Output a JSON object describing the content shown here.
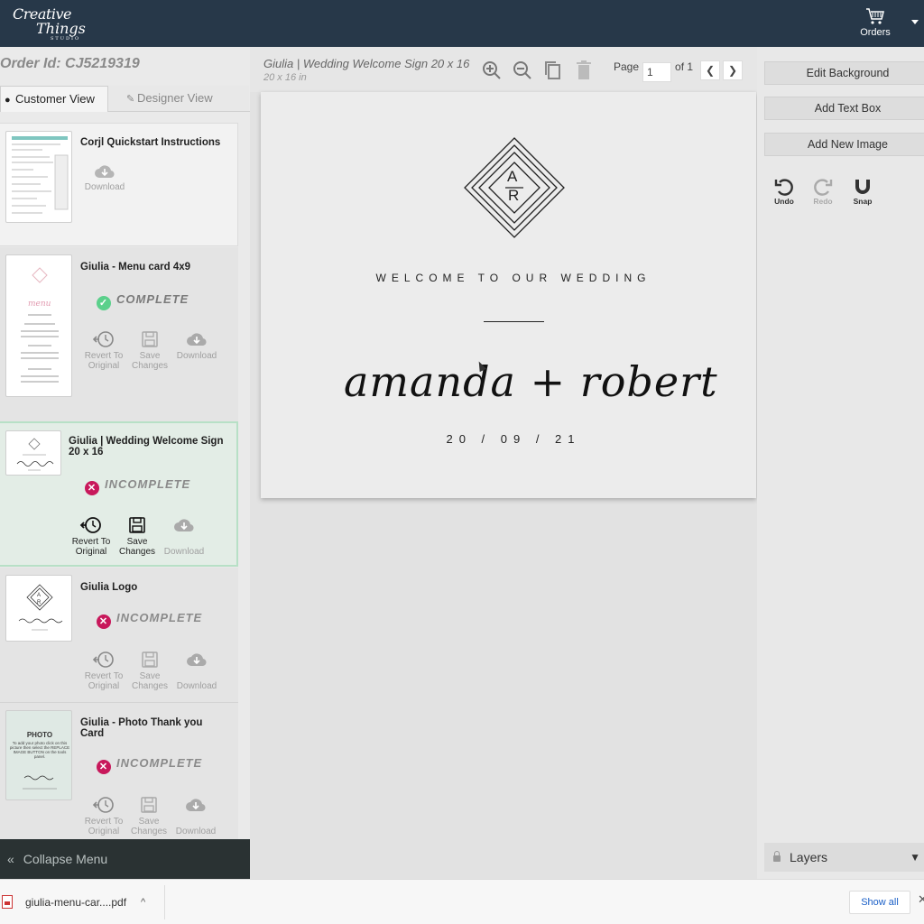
{
  "brand": {
    "line1": "Creative",
    "line2": "Things",
    "line3": "STUDIO"
  },
  "header": {
    "orders_label": "Orders"
  },
  "order": {
    "id_label": "Order Id: CJ5219319"
  },
  "tabs": {
    "customer": "Customer View",
    "designer": "Designer View"
  },
  "items": [
    {
      "title": "Corjl Quickstart Instructions",
      "status": "",
      "actions": [
        "Download"
      ]
    },
    {
      "title": "Giulia - Menu card 4x9",
      "status": "COMPLETE",
      "actions": [
        "Revert To Original",
        "Save Changes",
        "Download"
      ]
    },
    {
      "title": "Giulia | Wedding Welcome Sign 20 x 16",
      "status": "INCOMPLETE",
      "actions": [
        "Revert To Original",
        "Save Changes",
        "Download"
      ]
    },
    {
      "title": "Giulia Logo",
      "status": "INCOMPLETE",
      "actions": [
        "Revert To Original",
        "Save Changes",
        "Download"
      ]
    },
    {
      "title": "Giulia - Photo Thank you Card",
      "status": "INCOMPLETE",
      "actions": [
        "Revert To Original",
        "Save Changes",
        "Download"
      ]
    }
  ],
  "actions": {
    "download": "Download",
    "revert_1": "Revert To",
    "revert_2": "Original",
    "save_1": "Save",
    "save_2": "Changes"
  },
  "collapse_label": "Collapse Menu",
  "document": {
    "title": "Giulia | Wedding Welcome Sign 20 x 16",
    "size": "20 x 16 in"
  },
  "pager": {
    "label": "Page",
    "current": "1",
    "of": "of 1"
  },
  "artboard": {
    "monogram_top": "A",
    "monogram_bottom": "R",
    "welcome": "WELCOME TO OUR WEDDING",
    "names": "amanda + robert",
    "date": "20 / 09 / 21"
  },
  "right": {
    "edit_background": "Edit Background",
    "add_text_box": "Add Text Box",
    "add_new_image": "Add New Image",
    "undo": "Undo",
    "redo": "Redo",
    "snap": "Snap",
    "layers": "Layers"
  },
  "downloads": {
    "file": "giulia-menu-car....pdf",
    "show_all": "Show all"
  },
  "thumbs": {
    "photo_label": "PHOTO",
    "photo_text": "To add your photo click on this picture then select the REPLACE IMAGE BUTTON on the tools panel."
  },
  "colors": {
    "topbar": "#273849",
    "complete": "#5bd08b",
    "incomplete": "#c8185b",
    "selected_border": "#b7e0c6",
    "link": "#1a5fc7"
  }
}
